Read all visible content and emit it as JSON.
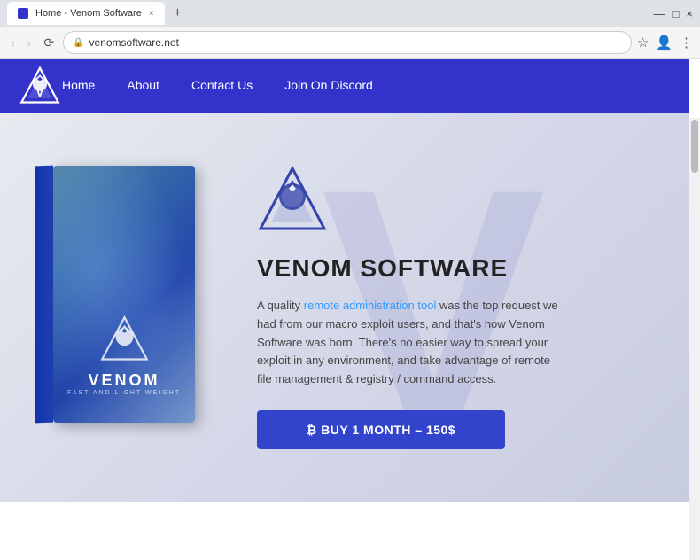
{
  "browser": {
    "tab_title": "Home - Venom Software",
    "tab_close": "×",
    "new_tab": "+",
    "controls": {
      "minimize": "—",
      "maximize": "□",
      "close": "×"
    },
    "nav": {
      "back": "‹",
      "forward": "›",
      "refresh": "⟳",
      "lock_icon": "🔒",
      "url": "venomsoftware.net",
      "star": "☆",
      "account": "👤",
      "menu": "⋮"
    }
  },
  "site": {
    "nav": {
      "home": "Home",
      "about": "About",
      "contact": "Contact Us",
      "discord": "Join On Discord"
    },
    "hero": {
      "title": "VENOM SOFTWARE",
      "description_before": "A quality ",
      "link_text": "remote administration tool",
      "description_after": " was the top request we had from our macro exploit users, and that's how Venom Software was born. There's no easier way to spread your exploit in any environment, and take advantage of remote file management & registry / command access.",
      "buy_button": "⚡ BUY 1 MONTH – 150$",
      "box_title": "VENOM",
      "box_subtitle": "FAST AND LIGHT WEIGHT"
    }
  },
  "colors": {
    "nav_bg": "#3333cc",
    "buy_btn": "#3344cc",
    "link": "#3399ff"
  }
}
